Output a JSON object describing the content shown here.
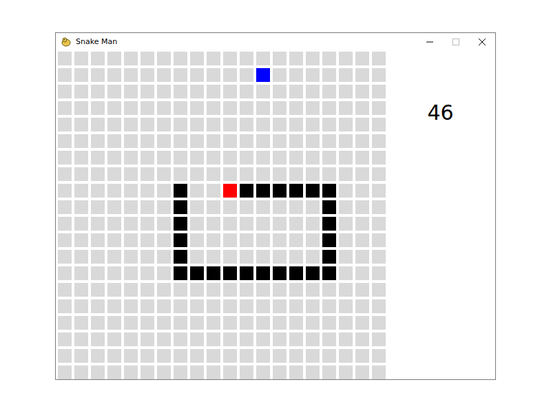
{
  "window": {
    "title": "Snake Man"
  },
  "board": {
    "columns": 20,
    "rows": 20
  },
  "score": "46",
  "food": {
    "x": 12,
    "y": 1,
    "kind": "food"
  },
  "snake": [
    {
      "x": 10,
      "y": 8,
      "kind": "head"
    },
    {
      "x": 11,
      "y": 8,
      "kind": "body"
    },
    {
      "x": 12,
      "y": 8,
      "kind": "body"
    },
    {
      "x": 13,
      "y": 8,
      "kind": "body"
    },
    {
      "x": 14,
      "y": 8,
      "kind": "body"
    },
    {
      "x": 15,
      "y": 8,
      "kind": "body"
    },
    {
      "x": 16,
      "y": 8,
      "kind": "body"
    },
    {
      "x": 16,
      "y": 9,
      "kind": "body"
    },
    {
      "x": 16,
      "y": 10,
      "kind": "body"
    },
    {
      "x": 16,
      "y": 11,
      "kind": "body"
    },
    {
      "x": 16,
      "y": 12,
      "kind": "body"
    },
    {
      "x": 16,
      "y": 13,
      "kind": "body"
    },
    {
      "x": 15,
      "y": 13,
      "kind": "body"
    },
    {
      "x": 14,
      "y": 13,
      "kind": "body"
    },
    {
      "x": 13,
      "y": 13,
      "kind": "body"
    },
    {
      "x": 12,
      "y": 13,
      "kind": "body"
    },
    {
      "x": 11,
      "y": 13,
      "kind": "body"
    },
    {
      "x": 10,
      "y": 13,
      "kind": "body"
    },
    {
      "x": 9,
      "y": 13,
      "kind": "body"
    },
    {
      "x": 8,
      "y": 13,
      "kind": "body"
    },
    {
      "x": 7,
      "y": 13,
      "kind": "body"
    },
    {
      "x": 7,
      "y": 12,
      "kind": "body"
    },
    {
      "x": 7,
      "y": 11,
      "kind": "body"
    },
    {
      "x": 7,
      "y": 10,
      "kind": "body"
    },
    {
      "x": 7,
      "y": 9,
      "kind": "body"
    },
    {
      "x": 7,
      "y": 8,
      "kind": "body"
    }
  ]
}
